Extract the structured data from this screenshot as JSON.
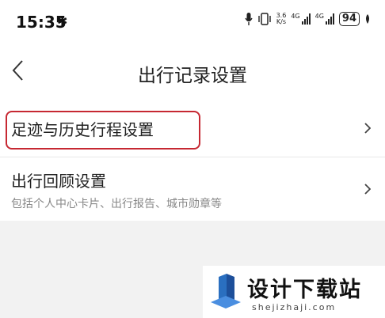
{
  "status_bar": {
    "time": "15:35",
    "bluetooth": "✱",
    "speed_value": "3.6",
    "speed_unit": "K/s",
    "net1": "4G",
    "net2": "4G",
    "battery": "94",
    "icons": [
      "bluetooth-icon",
      "mic-icon",
      "vibrate-icon",
      "signal-icon",
      "battery-icon",
      "leaf-icon"
    ]
  },
  "header": {
    "title": "出行记录设置",
    "back_icon": "chevron-left-icon"
  },
  "menu": {
    "items": [
      {
        "label": "足迹与历史行程设置",
        "highlighted": true,
        "highlight_color": "#c62832"
      },
      {
        "label": "出行回顾设置",
        "subtitle": "包括个人中心卡片、出行报告、城市勋章等"
      }
    ]
  },
  "watermark": {
    "brand": "设计下载站",
    "url": "shejizhaji.com",
    "logo_color": "#2a6fc0"
  }
}
